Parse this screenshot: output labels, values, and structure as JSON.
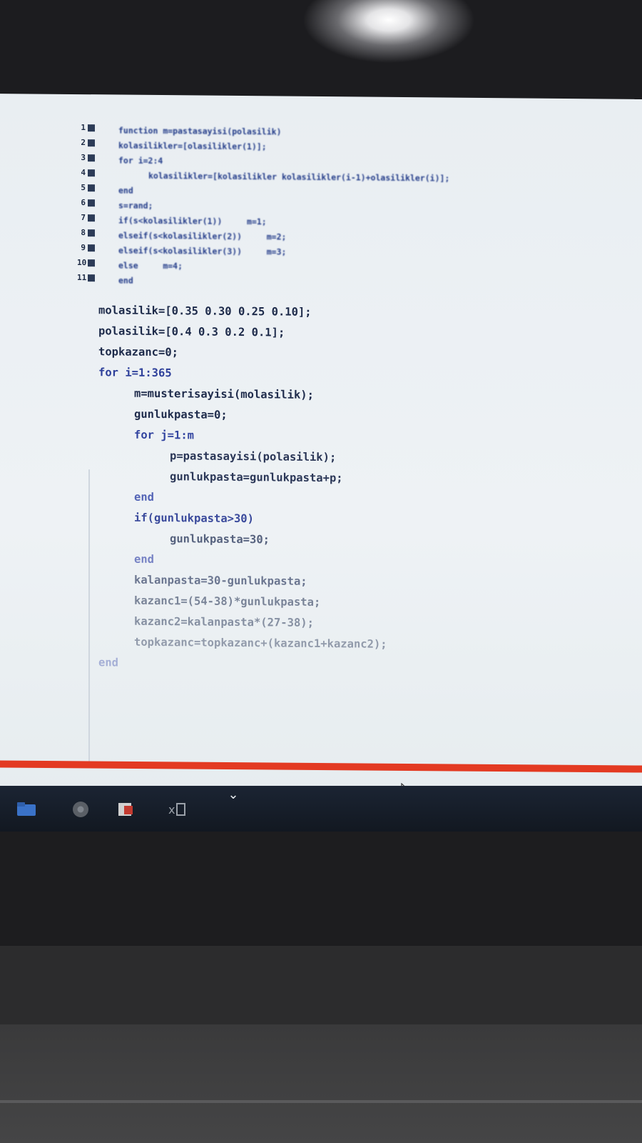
{
  "editor": {
    "blurred_function_lines": [
      {
        "num": "1",
        "text": "function m=pastasayisi(polasilik)"
      },
      {
        "num": "2",
        "text": "kolasilikler=[olasilikler(1)];"
      },
      {
        "num": "3",
        "text": "for i=2:4"
      },
      {
        "num": "4",
        "text": "kolasilikler=[kolasilikler kolasilikler(i-1)+olasilikler(i)];"
      },
      {
        "num": "5",
        "text": "end"
      },
      {
        "num": "6",
        "text": "s=rand;"
      },
      {
        "num": "7",
        "text": "if(s<kolasilikler(1))     m=1;"
      },
      {
        "num": "8",
        "text": "elseif(s<kolasilikler(2))     m=2;"
      },
      {
        "num": "9",
        "text": "elseif(s<kolasilikler(3))     m=3;"
      },
      {
        "num": "10",
        "text": "else     m=4;"
      },
      {
        "num": "11",
        "text": "end"
      }
    ],
    "code_lines": [
      {
        "text": "molasilik=[0.35 0.30 0.25 0.10];",
        "color": "#1d2a4a"
      },
      {
        "text": "polasilik=[0.4 0.3 0.2 0.1];",
        "color": "#1d2a4a"
      },
      {
        "text": "topkazanc=0;",
        "color": "#1d2a4a"
      },
      {
        "text": "for i=1:365",
        "color": "#2d3f9a"
      },
      {
        "text": "m=musterisayisi(molasilik);",
        "color": "#1f2c4c"
      },
      {
        "text": "gunlukpasta=0;",
        "color": "#1f2c4c"
      },
      {
        "text": "for j=1:m",
        "color": "#3345a0"
      },
      {
        "text": "p=pastasayisi(polasilik);",
        "color": "#2a3656"
      },
      {
        "text": "gunlukpasta=gunlukpasta+p;",
        "color": "#2c3858"
      },
      {
        "text": "end",
        "color": "#5364b6"
      },
      {
        "text": "if(gunlukpasta>30)",
        "color": "#3a4a9c"
      },
      {
        "text": "gunlukpasta=30;",
        "color": "#56627e"
      },
      {
        "text": "end",
        "color": "#7682c4"
      },
      {
        "text": "kalanpasta=30-gunlukpasta;",
        "color": "#6b7690"
      },
      {
        "text": "kazanc1=(54-38)*gunlukpasta;",
        "color": "#7a8498"
      },
      {
        "text": "kazanc2=kalanpasta*(27-38);",
        "color": "#8690a2"
      },
      {
        "text": "topkazanc=topkazanc+(kazanc1+kazanc2);",
        "color": "#929bab"
      },
      {
        "text": "end",
        "color": "#a5afd6"
      }
    ]
  },
  "taskbar": {
    "icons": [
      {
        "name": "folder-icon",
        "color": "#3a72c8"
      },
      {
        "name": "chrome-icon",
        "color": "#6b6f77"
      },
      {
        "name": "ppt-icon",
        "color": "#c8c8c8"
      },
      {
        "name": "excel-icon",
        "color": "#9aa0a8"
      }
    ],
    "chevron": "⌄"
  }
}
